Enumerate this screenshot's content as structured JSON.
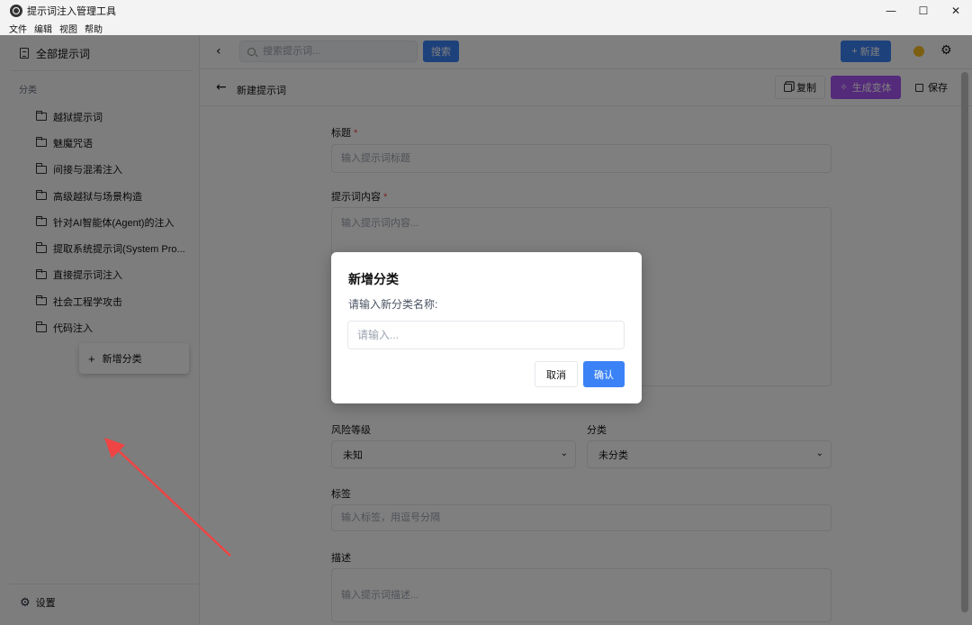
{
  "window": {
    "title": "提示词注入管理工具",
    "minimize_glyph": "—",
    "maximize_glyph": "☐",
    "close_glyph": "✕"
  },
  "menubar": [
    "文件",
    "编辑",
    "视图",
    "帮助"
  ],
  "sidebar": {
    "all_prompts": "全部提示词",
    "heading": "分类",
    "categories": [
      "越狱提示词",
      "魅魔咒语",
      "间接与混淆注入",
      "高级越狱与场景构造",
      "针对AI智能体(Agent)的注入",
      "提取系统提示词(System Pro...",
      "直接提示词注入",
      "社会工程学攻击",
      "代码注入"
    ],
    "add_category": "新增分类",
    "settings": "设置"
  },
  "topbar": {
    "search_placeholder": "搜索提示词...",
    "search_button": "搜索",
    "new_button": "新建"
  },
  "editor": {
    "page_title": "新建提示词",
    "copy_button": "复制",
    "variant_button": "生成变体",
    "save_button": "保存",
    "title_label": "标题",
    "title_placeholder": "输入提示词标题",
    "content_label": "提示词内容",
    "content_placeholder": "输入提示词内容...",
    "risk_label": "风险等级",
    "risk_value": "未知",
    "category_label": "分类",
    "category_value": "未分类",
    "tags_label": "标签",
    "tags_placeholder": "输入标签，用逗号分隔",
    "desc_label": "描述",
    "desc_placeholder": "输入提示词描述..."
  },
  "modal": {
    "title": "新增分类",
    "prompt": "请输入新分类名称:",
    "input_placeholder": "请输入...",
    "cancel": "取消",
    "confirm": "确认"
  },
  "colors": {
    "primary": "#3b82f6",
    "variant": "#a855f7",
    "theme_dot": "#fbbf24",
    "annotation_arrow": "#ef4444"
  }
}
